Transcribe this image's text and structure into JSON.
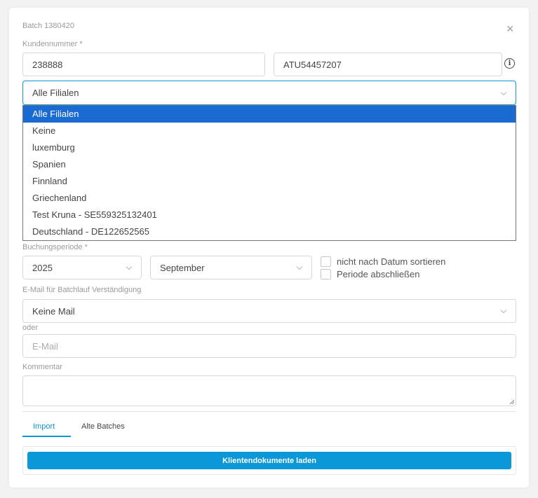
{
  "header": {
    "batch_label": "Batch 1380420",
    "close_glyph": "×"
  },
  "customer": {
    "label": "Kundennummer *",
    "number_value": "238888",
    "vat_value": "ATU54457207",
    "info_glyph": "i"
  },
  "branch_select": {
    "selected": "Alle Filialen",
    "options": [
      "Alle Filialen",
      "Keine",
      "luxemburg",
      "Spanien",
      "Finnland",
      "Griechenland",
      "Test Kruna - SE559325132401",
      "Deutschland - DE122652565"
    ]
  },
  "period": {
    "label": "Buchungsperiode *",
    "year": "2025",
    "month": "September",
    "no_date_sort_label": "nicht nach Datum sortieren",
    "close_period_label": "Periode abschließen"
  },
  "email": {
    "label": "E-Mail für Batchlauf Verständigung",
    "selected": "Keine Mail",
    "or_label": "oder",
    "placeholder": "E-Mail"
  },
  "comment": {
    "label": "Kommentar"
  },
  "tabs": [
    "Import",
    "Alte Batches"
  ],
  "load_button_label": "Klientendokumente laden",
  "colors": {
    "accent": "#0b98d9",
    "selected_option": "#1a6ad2",
    "border": "#d8d8d8"
  }
}
